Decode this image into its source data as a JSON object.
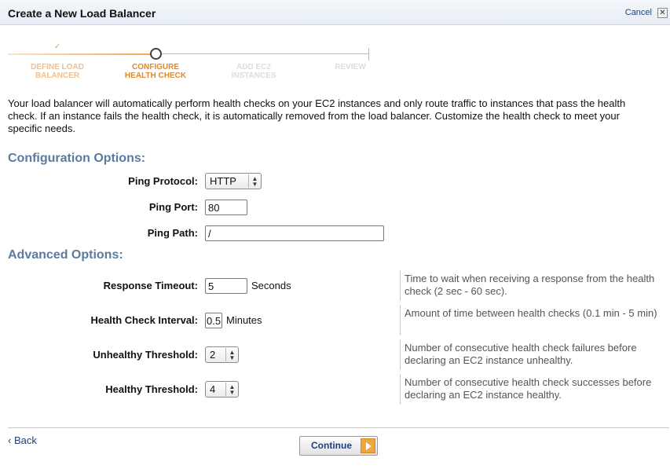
{
  "dialog": {
    "title": "Create a New Load Balancer",
    "cancel_label": "Cancel",
    "close_glyph": "✕"
  },
  "wizard": {
    "check_glyph": "✓",
    "steps": [
      {
        "label": "DEFINE LOAD\nBALANCER",
        "state": "done"
      },
      {
        "label": "CONFIGURE\nHEALTH CHECK",
        "state": "current"
      },
      {
        "label": "ADD EC2\nINSTANCES",
        "state": "pending"
      },
      {
        "label": "REVIEW",
        "state": "pending"
      }
    ]
  },
  "intro_text": "Your load balancer will automatically perform health checks on your EC2 instances and only route traffic to instances that pass the health check. If an instance fails the health check, it is automatically removed from the load balancer. Customize the health check to meet your specific needs.",
  "config": {
    "heading": "Configuration Options:",
    "ping_protocol": {
      "label": "Ping Protocol:",
      "value": "HTTP"
    },
    "ping_port": {
      "label": "Ping Port:",
      "value": "80"
    },
    "ping_path": {
      "label": "Ping Path:",
      "value": "/"
    }
  },
  "advanced": {
    "heading": "Advanced Options:",
    "response_timeout": {
      "label": "Response Timeout:",
      "value": "5",
      "unit": "Seconds",
      "help": "Time to wait when receiving a response from the health check (2 sec - 60 sec)."
    },
    "health_check_interval": {
      "label": "Health Check Interval:",
      "value": "0.5",
      "unit": "Minutes",
      "help": "Amount of time between health checks (0.1 min - 5 min)"
    },
    "unhealthy_threshold": {
      "label": "Unhealthy Threshold:",
      "value": "2",
      "help": "Number of consecutive health check failures before declaring an EC2 instance unhealthy."
    },
    "healthy_threshold": {
      "label": "Healthy Threshold:",
      "value": "4",
      "help": "Number of consecutive health check successes before declaring an EC2 instance healthy."
    }
  },
  "footer": {
    "back_label": "‹ Back",
    "continue_label": "Continue"
  },
  "colors": {
    "section_heading": "#5a7aa0",
    "link": "#1c3f80",
    "wizard_active": "#e28a2b",
    "continue_arrow": "#f0a640"
  },
  "icons": {
    "close": "close-icon",
    "select_arrows": "up-down-arrows-icon",
    "continue_arrow": "play-arrow-icon",
    "step_check": "check-icon"
  }
}
